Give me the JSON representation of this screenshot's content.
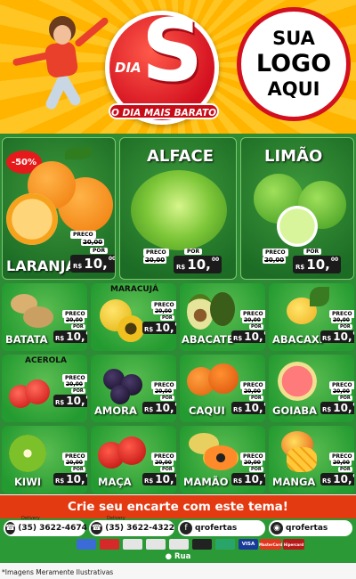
{
  "header": {
    "badge_small": "DIA",
    "badge_letter": "S",
    "badge_ribbon": "O DIA MAIS BARATO",
    "logo_lines": [
      "SUA",
      "LOGO",
      "AQUI"
    ]
  },
  "featured": [
    {
      "name": "LARANJA",
      "badge": "-50%",
      "preco_label": "PRECO",
      "old_price": "20,00",
      "por_label": "POR",
      "currency": "R$",
      "price": "10",
      "cents": "00"
    },
    {
      "name": "ALFACE",
      "preco_label": "PRECO",
      "old_price": "20,00",
      "por_label": "POR",
      "currency": "R$",
      "price": "10",
      "cents": "00"
    },
    {
      "name": "LIMÃO",
      "preco_label": "PRECO",
      "old_price": "20,00",
      "por_label": "POR",
      "currency": "R$",
      "price": "10",
      "cents": "00"
    }
  ],
  "products": [
    {
      "name": "BATATA",
      "old_price": "20,00",
      "currency": "R$",
      "price": "10",
      "cents": "00"
    },
    {
      "name": "",
      "subtitle": "MARACUJÁ",
      "old_price": "20,00",
      "currency": "R$",
      "price": "10",
      "cents": "00"
    },
    {
      "name": "ABACATE",
      "old_price": "20,00",
      "currency": "R$",
      "price": "10",
      "cents": "00"
    },
    {
      "name": "ABACAXI",
      "old_price": "20,00",
      "currency": "R$",
      "price": "10",
      "cents": "00"
    },
    {
      "name": "",
      "subtitle": "ACEROLA",
      "old_price": "20,00",
      "currency": "R$",
      "price": "10",
      "cents": "00"
    },
    {
      "name": "AMORA",
      "old_price": "20,00",
      "currency": "R$",
      "price": "10",
      "cents": "00"
    },
    {
      "name": "CAQUI",
      "old_price": "20,00",
      "currency": "R$",
      "price": "10",
      "cents": "00"
    },
    {
      "name": "GOIABA",
      "old_price": "20,00",
      "currency": "R$",
      "price": "10",
      "cents": "00"
    },
    {
      "name": "KIWI",
      "old_price": "20,00",
      "currency": "R$",
      "price": "10",
      "cents": "00"
    },
    {
      "name": "MAÇA",
      "old_price": "20,00",
      "currency": "R$",
      "price": "10",
      "cents": "00"
    },
    {
      "name": "MAMÃO",
      "old_price": "20,00",
      "currency": "R$",
      "price": "10",
      "cents": "00"
    },
    {
      "name": "MANGA",
      "old_price": "20,00",
      "currency": "R$",
      "price": "10",
      "cents": "00"
    }
  ],
  "labels": {
    "preco": "PRECO",
    "por": "POR"
  },
  "cta": "Crie seu encarte com este tema!",
  "contacts": [
    {
      "label": "Delivery",
      "icon": "phone-icon",
      "text": "(35) 3622-4674"
    },
    {
      "label": "Delivery",
      "icon": "phone-icon",
      "text": "(35) 3622-4322"
    },
    {
      "label": "",
      "icon": "facebook-icon",
      "text": "qrofertas"
    },
    {
      "label": "",
      "icon": "instagram-icon",
      "text": "qrofertas"
    }
  ],
  "payments": [
    "VISA",
    "MasterCard",
    "Hipercard"
  ],
  "address": "Rua",
  "disclaimer": "*Imagens Meramente Ilustrativas",
  "colors": {
    "header_yellow": "#ffb400",
    "badge_red": "#d3101f",
    "grid_green": "#2d8a35",
    "cta_orange": "#e33a12"
  }
}
